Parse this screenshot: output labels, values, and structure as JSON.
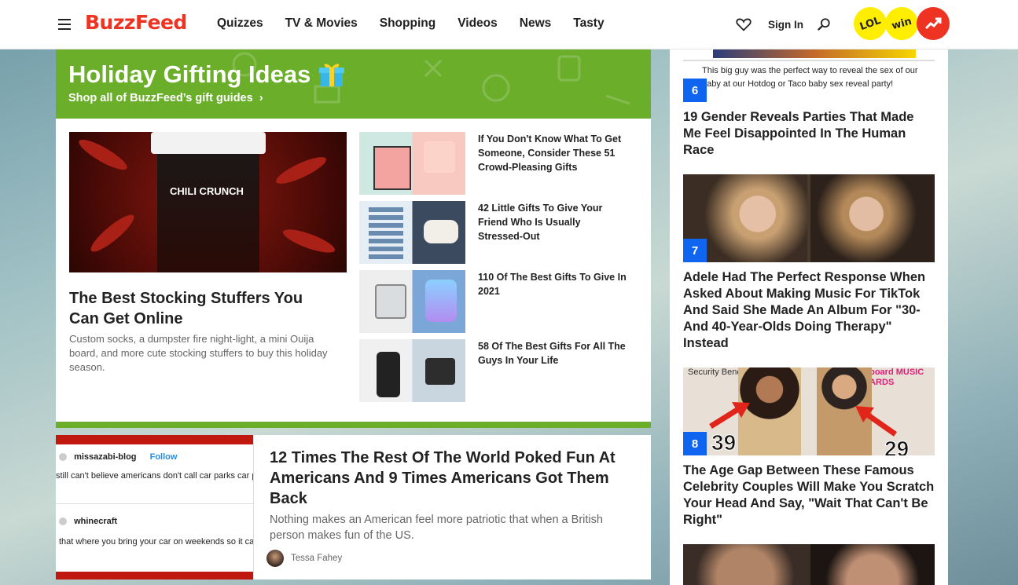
{
  "header": {
    "logo": "BuzzFeed",
    "nav": [
      "Quizzes",
      "TV & Movies",
      "Shopping",
      "Videos",
      "News",
      "Tasty"
    ],
    "sign_in": "Sign In",
    "badges": [
      "LOL",
      "win",
      "trending"
    ]
  },
  "gifting": {
    "title": "Holiday Gifting Ideas",
    "link": "Shop all of BuzzFeed’s gift guides",
    "featured": {
      "image_label": "CHILI CRUNCH",
      "title": "The Best Stocking Stuffers You Can Get Online",
      "description": "Custom socks, a dumpster fire night-light, a mini Ouija board, and more cute stocking stuffers to buy this holiday season."
    },
    "items": [
      {
        "title": "If You Don't Know What To Get Someone, Consider These 51 Crowd-Pleasing Gifts"
      },
      {
        "title": "42 Little Gifts To Give Your Friend Who Is Usually Stressed-Out"
      },
      {
        "title": "110 Of The Best Gifts To Give In 2021"
      },
      {
        "title": "58 Of The Best Gifts For All The Guys In Your Life"
      }
    ]
  },
  "story": {
    "image_rows": [
      {
        "user": "missazabi-blog",
        "action": "Follow",
        "text": "still can't believe americans don't call car parks car parks wtf"
      },
      {
        "user": "whinecraft",
        "text": "that where you bring your car on weekends so it can play with other cars"
      }
    ],
    "title": "12 Times The Rest Of The World Poked Fun At Americans And 9 Times Americans Got Them Back",
    "description": "Nothing makes an American feel more patriotic that when a British person makes fun of the US.",
    "author": "Tessa Fahey"
  },
  "trending": [
    {
      "number": "6",
      "caption": "This big guy was the perfect way to reveal the sex of our baby at our Hotdog or Taco baby sex reveal party!",
      "title": "19 Gender Reveals Parties That Made Me Feel Disappointed In The Human Race"
    },
    {
      "number": "7",
      "title": "Adele Had The Perfect Response When Asked About Making Music For TikTok And Said She Made An Album For \"30- And 40-Year-Olds Doing Therapy\" Instead"
    },
    {
      "number": "8",
      "image_text": [
        "Security Benefit",
        "Billboard MUSIC AWARDS",
        "39",
        "29"
      ],
      "title": "The Age Gap Between These Famous Celebrity Couples Will Make You Scratch Your Head And Say, \"Wait That Can't Be Right\""
    }
  ]
}
